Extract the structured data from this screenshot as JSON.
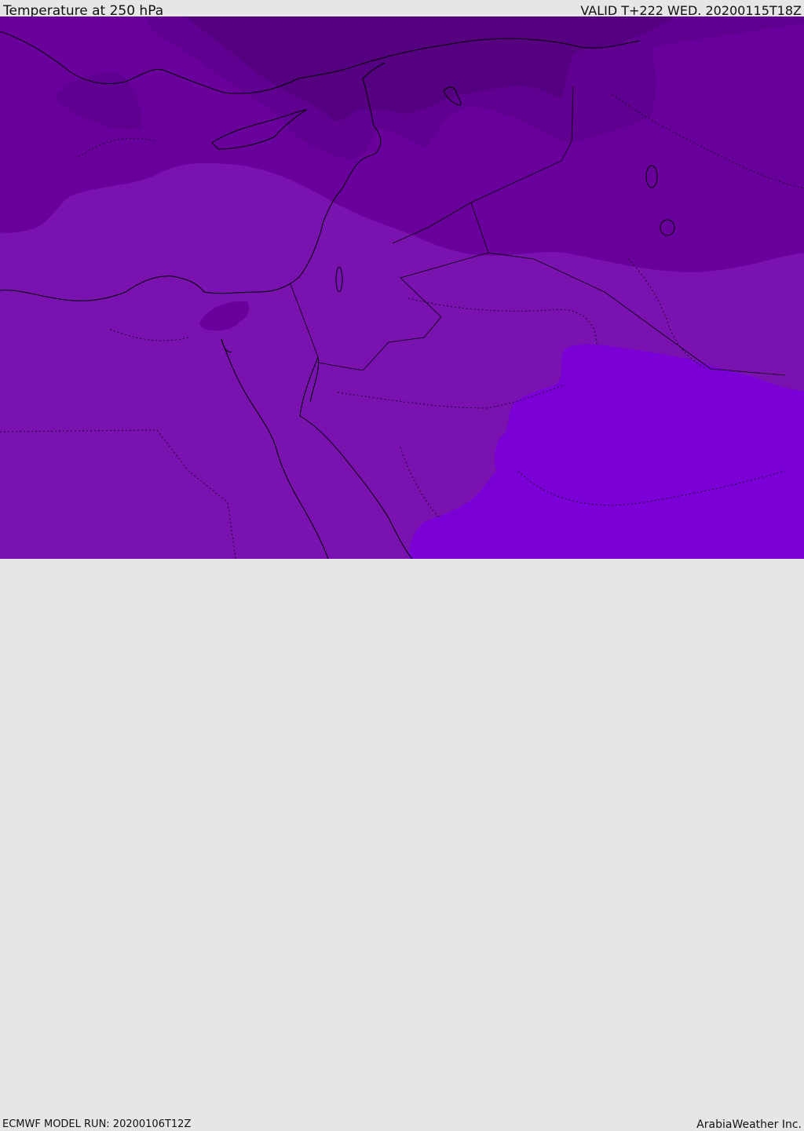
{
  "header": {
    "title": "Temperature at 250 hPa",
    "valid": "VALID T+222 WED. 20200115T18Z"
  },
  "footer": {
    "model_run": "ECMWF MODEL RUN: 20200106T12Z",
    "credit": "ArabiaWeather Inc."
  },
  "colors": {
    "darkest": "#540080",
    "darker": "#5f0090",
    "dark": "#6a009c",
    "mid": "#7a12b0",
    "light": "#7a00d6",
    "border": "#000000"
  }
}
